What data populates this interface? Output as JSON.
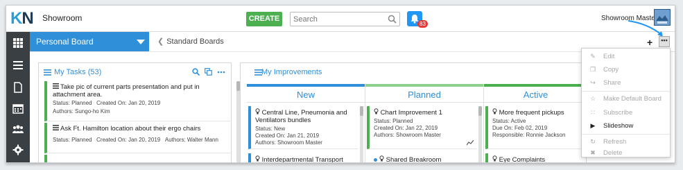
{
  "app": {
    "logo_k": "K",
    "logo_n": "N",
    "name": "Showroom"
  },
  "header": {
    "create_label": "CREATE",
    "search_placeholder": "Search",
    "notifications_count": "83",
    "user_name": "Showroom Master"
  },
  "subbar": {
    "board_name": "Personal Board",
    "standard_boards_label": "Standard Boards",
    "add_symbol": "+",
    "more_symbol": "•••"
  },
  "tasks_panel": {
    "title": "My Tasks (53)",
    "tasks": [
      {
        "title": "Take pic of current parts presentation and put in attachment area.",
        "status": "Status: Planned",
        "created": "Created On: Jan 20, 2019",
        "authors": "Authors: Sungo-ho Kim"
      },
      {
        "title": "Ask Ft. Hamilton location about their ergo chairs",
        "status": "Status: Planned",
        "created": "Created On: Jan 20, 2019",
        "authors": "Authors: Walter Mann"
      }
    ]
  },
  "improvements_panel": {
    "title": "My Improvements",
    "columns": [
      {
        "name": "New",
        "color": "#2f8fd8",
        "cards": [
          {
            "title": "Central Line, Pneumonia and Ventilators bundles",
            "line1": "Status: New",
            "line2": "Created On: Jan 21, 2019",
            "line3": "Authors: Showroom Master",
            "color": "#2f8fd8"
          },
          {
            "title": "Interdepartmental Transport",
            "color": "#2f8fd8"
          }
        ]
      },
      {
        "name": "Planned",
        "color": "#8ed18e",
        "cards": [
          {
            "title": "Chart Improvement 1",
            "line1": "Status: Planned",
            "line2": "Created On: Jan 22, 2019",
            "line3": "Authors: Showroom Master",
            "color": "#4caf50"
          },
          {
            "title": "Shared Breakroom",
            "color": "#ffffff"
          }
        ]
      },
      {
        "name": "Active",
        "color": "#4caf50",
        "cards": [
          {
            "title": "More frequent pickups",
            "line1": "Status: Active",
            "line2": "Due On: Feb 02, 2019",
            "line3": "Responsible: Ronnie Jackson",
            "color": "#4caf50"
          },
          {
            "title": "Eye Complaints",
            "color": "#4caf50"
          }
        ]
      }
    ]
  },
  "menu": {
    "items": [
      {
        "label": "Edit",
        "icon": "pencil-icon",
        "glyph": "✎",
        "enabled": false
      },
      {
        "label": "Copy",
        "icon": "copy-icon",
        "glyph": "❐",
        "enabled": false
      },
      {
        "label": "Share",
        "icon": "share-icon",
        "glyph": "↪",
        "enabled": false
      },
      {
        "label": "Make Default Board",
        "icon": "star-icon",
        "glyph": "☆",
        "enabled": false
      },
      {
        "label": "Subscribe",
        "icon": "rss-icon",
        "glyph": "∷",
        "enabled": false
      },
      {
        "label": "Slideshow",
        "icon": "play-icon",
        "glyph": "▶",
        "enabled": true
      },
      {
        "label": "Refresh",
        "icon": "refresh-icon",
        "glyph": "↻",
        "enabled": false
      },
      {
        "label": "Delete",
        "icon": "close-icon",
        "glyph": "✖",
        "enabled": false
      }
    ]
  }
}
